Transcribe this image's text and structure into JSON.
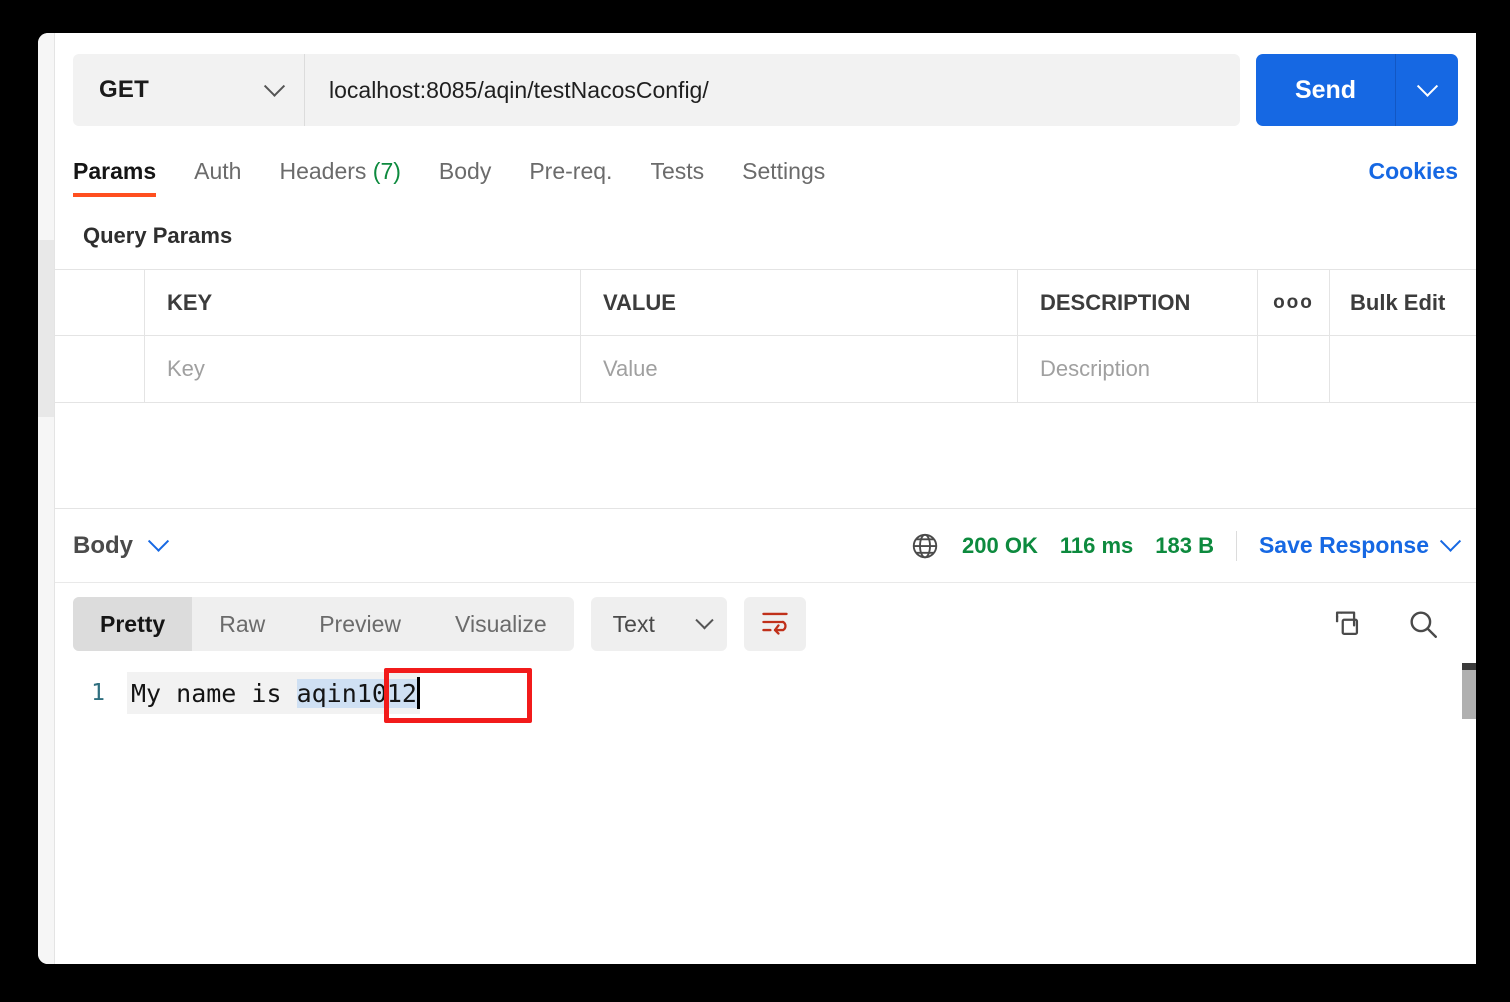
{
  "request": {
    "method": "GET",
    "method_icon": "chevron-down-icon",
    "url": "localhost:8085/aqin/testNacosConfig/",
    "url_placeholder": "Enter URL or paste text",
    "send_label": "Send",
    "send_options_icon": "chevron-down-icon"
  },
  "request_tabs": [
    {
      "label": "Params",
      "count": "",
      "active": true
    },
    {
      "label": "Auth",
      "count": "",
      "active": false
    },
    {
      "label": "Headers",
      "count": "(7)",
      "active": false
    },
    {
      "label": "Body",
      "count": "",
      "active": false
    },
    {
      "label": "Pre-req.",
      "count": "",
      "active": false
    },
    {
      "label": "Tests",
      "count": "",
      "active": false
    },
    {
      "label": "Settings",
      "count": "",
      "active": false
    }
  ],
  "cookies_label": "Cookies",
  "query_params": {
    "title": "Query Params",
    "columns": [
      "",
      "KEY",
      "VALUE",
      "DESCRIPTION"
    ],
    "more_icon": "ooo",
    "bulk_edit_label": "Bulk Edit",
    "rows": [
      {
        "key_placeholder": "Key",
        "value_placeholder": "Value",
        "description_placeholder": "Description"
      }
    ]
  },
  "response": {
    "body_label": "Body",
    "body_dropdown_icon": "chevron-down-icon",
    "network_icon": "globe-icon",
    "status": "200 OK",
    "time": "116 ms",
    "size": "183 B",
    "save_label": "Save Response",
    "save_dropdown_icon": "chevron-down-icon",
    "view_tabs": [
      {
        "label": "Pretty",
        "active": true
      },
      {
        "label": "Raw",
        "active": false
      },
      {
        "label": "Preview",
        "active": false
      },
      {
        "label": "Visualize",
        "active": false
      }
    ],
    "format": "Text",
    "format_dropdown_icon": "chevron-down-icon",
    "wrap_icon": "wrap-text-icon",
    "copy_icon": "copy-icon",
    "search_icon": "search-icon",
    "body_lines": [
      {
        "number": "1",
        "prefix": "My name is ",
        "selected": "aqin1012"
      }
    ]
  },
  "colors": {
    "accent_orange": "#ff4f1f",
    "link_blue": "#1668e3",
    "status_green": "#0d8a3e",
    "annotation_red": "#f21b1b",
    "selection_blue": "#cfe0f3"
  }
}
